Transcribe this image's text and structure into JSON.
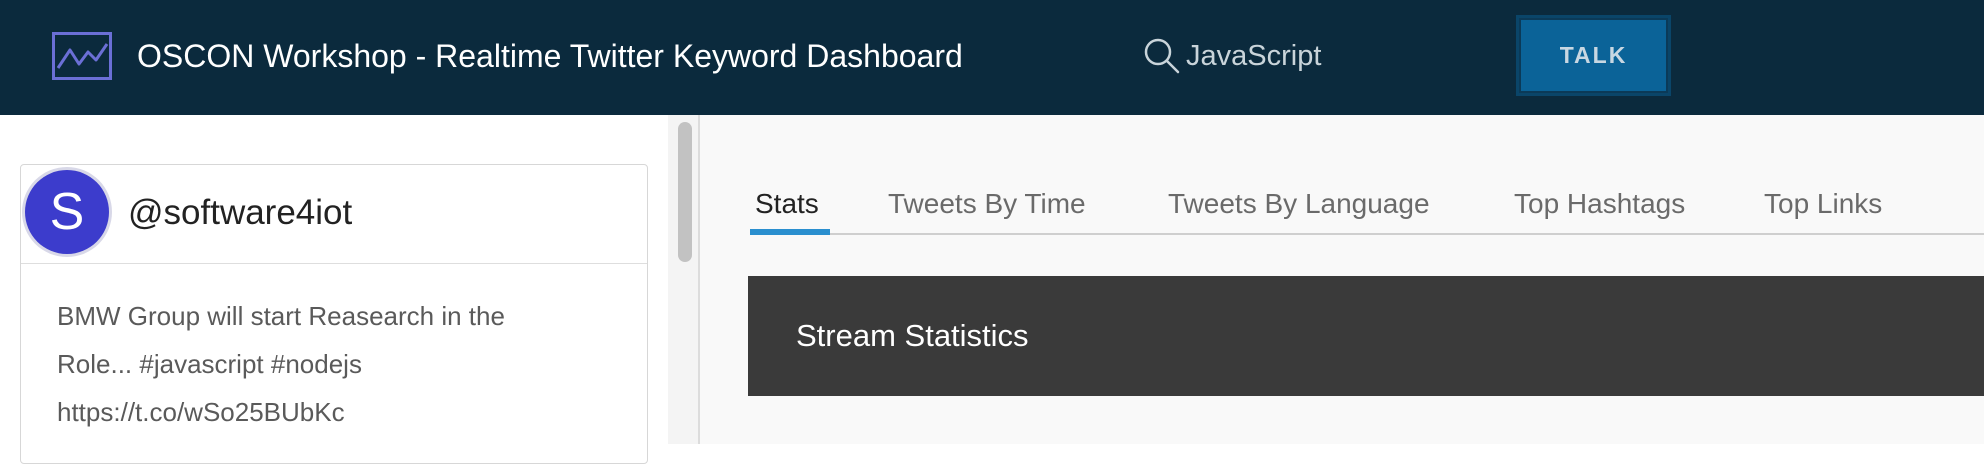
{
  "header": {
    "logo_icon": "line-chart-icon",
    "title": "OSCON Workshop - Realtime Twitter Keyword Dashboard",
    "search": {
      "icon": "search-icon",
      "value": "JavaScript"
    },
    "talk_button_label": "TALK"
  },
  "feed": {
    "tweets": [
      {
        "avatar_letter": "S",
        "username": "@software4iot",
        "text_lines": [
          "BMW Group will start Reasearch in the",
          "Role... #javascript #nodejs",
          "https://t.co/wSo25BUbKc"
        ]
      }
    ]
  },
  "main": {
    "tabs": [
      {
        "label": "Stats",
        "active": true
      },
      {
        "label": "Tweets By Time",
        "active": false
      },
      {
        "label": "Tweets By Language",
        "active": false
      },
      {
        "label": "Top Hashtags",
        "active": false
      },
      {
        "label": "Top Links",
        "active": false
      }
    ],
    "stats_banner_title": "Stream Statistics"
  },
  "colors": {
    "header_bg": "#0b2a3d",
    "accent": "#2a8fcf",
    "button_bg": "#0b6398",
    "avatar_bg": "#3c3ccc",
    "banner_bg": "#3a3a3a"
  }
}
